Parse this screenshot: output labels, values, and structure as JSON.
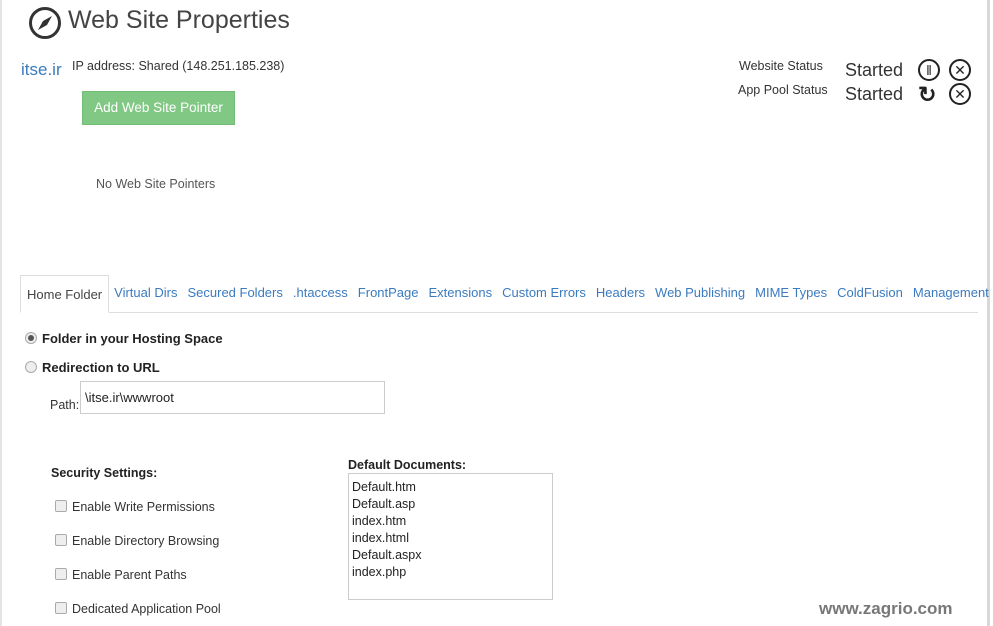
{
  "header": {
    "title": "Web Site Properties",
    "icon": "compass-icon"
  },
  "site": {
    "name": "itse.ir",
    "ip": "IP address: Shared (148.251.185.238)"
  },
  "add_pointer_label": "Add Web Site Pointer",
  "no_pointers": "No Web Site Pointers",
  "status": {
    "website_label": "Website Status",
    "website_value": "Started",
    "apppool_label": "App Pool Status",
    "apppool_value": "Started"
  },
  "tabs": [
    "Home Folder",
    "Virtual Dirs",
    "Secured Folders",
    ".htaccess",
    "FrontPage",
    "Extensions",
    "Custom Errors",
    "Headers",
    "Web Publishing",
    "MIME Types",
    "ColdFusion",
    "Management"
  ],
  "home": {
    "radio_folder": "Folder in your Hosting Space",
    "radio_redirect": "Redirection to URL",
    "selected": "folder",
    "path_label": "Path:",
    "path_value": "\\itse.ir\\wwwroot"
  },
  "security": {
    "title": "Security Settings:",
    "options": [
      {
        "label": "Enable Write Permissions",
        "checked": false
      },
      {
        "label": "Enable Directory Browsing",
        "checked": false
      },
      {
        "label": "Enable Parent Paths",
        "checked": false
      },
      {
        "label": "Dedicated Application Pool",
        "checked": false
      }
    ]
  },
  "default_docs": {
    "title": "Default Documents:",
    "items": [
      "Default.htm",
      "Default.asp",
      "index.htm",
      "index.html",
      "Default.aspx",
      "index.php"
    ]
  },
  "watermark": "www.zagrio.com",
  "colors": {
    "accent": "#3a7bbf",
    "button": "#80c883"
  }
}
